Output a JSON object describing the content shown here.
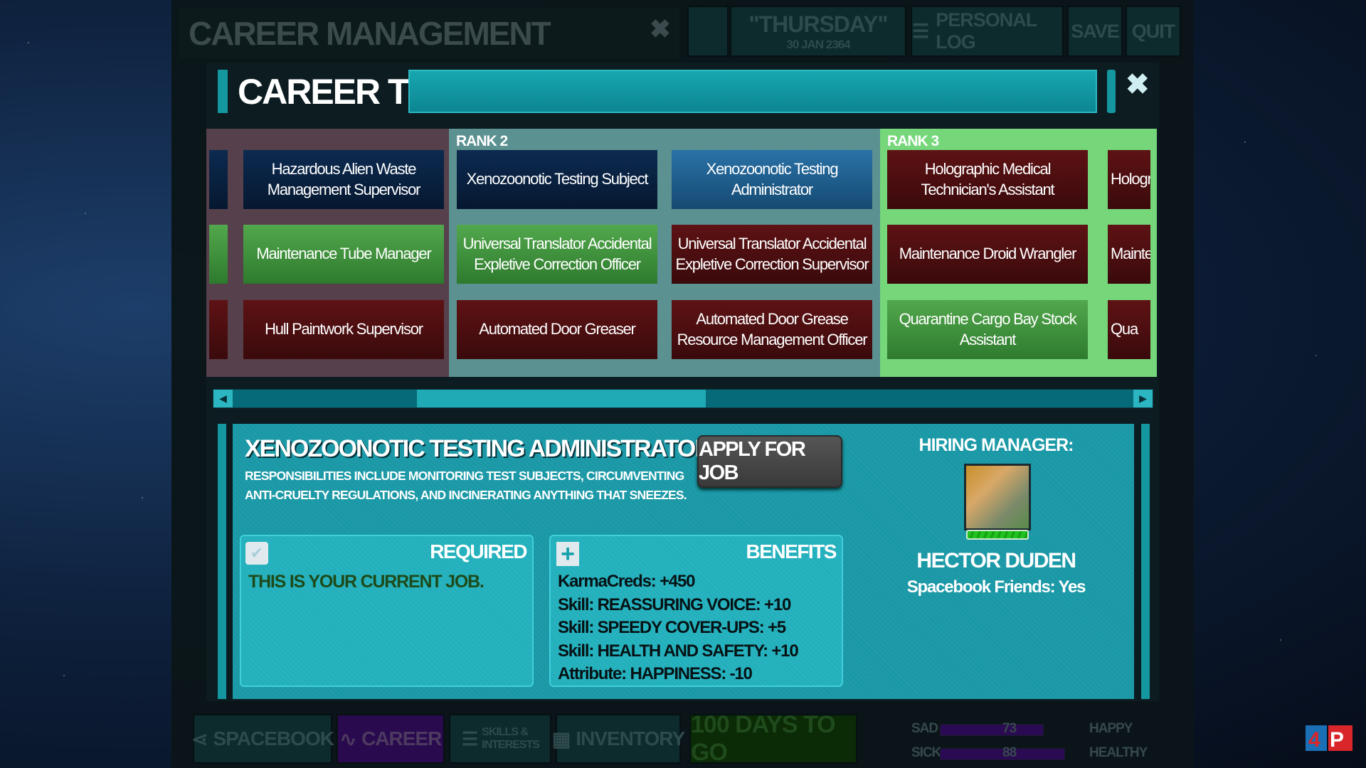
{
  "background_window": {
    "title": "CAREER MANAGEMENT",
    "day": "\"THURSDAY\"",
    "date": "30 JAN 2364",
    "personal_log": "PERSONAL LOG",
    "save": "SAVE",
    "quit": "QUIT"
  },
  "career_tree": {
    "title": "CAREER TREE",
    "columns": [
      {
        "rank": "",
        "color": "#56404b",
        "cards": [
          [
            "",
            "blue"
          ],
          [
            "Hazardous Alien Waste Management Supervisor",
            "blue"
          ],
          [
            "",
            "green"
          ],
          [
            "Maintenance Tube Manager",
            "green"
          ],
          [
            "",
            "red"
          ],
          [
            "Hull Paintwork Supervisor",
            "red"
          ]
        ]
      },
      {
        "rank": "RANK 2",
        "color": "#5c9192",
        "cards": [
          [
            "Xenozoonotic Testing Subject",
            "blue"
          ],
          [
            "Xenozoonotic Testing Administrator",
            "sel"
          ],
          [
            "Universal Translator Accidental Expletive Correction Officer",
            "green"
          ],
          [
            "Universal Translator Accidental Expletive Correction Supervisor",
            "red"
          ],
          [
            "Automated Door Greaser",
            "red"
          ],
          [
            "Automated Door Grease Resource Management Officer",
            "red"
          ]
        ]
      },
      {
        "rank": "RANK 3",
        "color": "#75d77a",
        "cards": [
          [
            "Holographic Medical Technician's Assistant",
            "red"
          ],
          [
            "Holograpl",
            "red"
          ],
          [
            "Maintenance Droid Wrangler",
            "red"
          ],
          [
            "Mainte",
            "red"
          ],
          [
            "Quarantine Cargo Bay Stock Assistant",
            "green"
          ],
          [
            "Qua",
            "red"
          ]
        ]
      }
    ],
    "scroll_position_percent": 25
  },
  "job": {
    "title": "XENOZOONOTIC TESTING ADMINISTRATOR",
    "description": "RESPONSIBILITIES INCLUDE MONITORING TEST SUBJECTS, CIRCUMVENTING ANTI-CRUELTY REGULATIONS, AND INCINERATING ANYTHING THAT SNEEZES.",
    "apply": "APPLY FOR JOB",
    "required_label": "REQUIRED",
    "required_text": "THIS IS YOUR CURRENT JOB.",
    "benefits_label": "BENEFITS",
    "benefits": [
      "KarmaCreds: +450",
      "Skill: REASSURING VOICE: +10",
      "Skill: SPEEDY COVER-UPS: +5",
      "Skill: HEALTH AND SAFETY: +10",
      "Attribute: HAPPINESS: -10"
    ],
    "hiring_label": "HIRING MANAGER:",
    "manager_name": "HECTOR DUDEN",
    "manager_friends": "Spacebook Friends: Yes",
    "manager_bar_percent": 100
  },
  "bottom": {
    "spacebook": "SPACEBOOK",
    "career": "CAREER",
    "skills": "SKILLS & INTERESTS",
    "inventory": "INVENTORY",
    "days": "100 DAYS TO GO",
    "meters": [
      {
        "left": "SAD",
        "right": "HAPPY",
        "value": 73
      },
      {
        "left": "SICK",
        "right": "HEALTHY",
        "value": 88
      }
    ]
  },
  "colors": {
    "accent": "#1597a0",
    "panel": "#1a98a6"
  }
}
